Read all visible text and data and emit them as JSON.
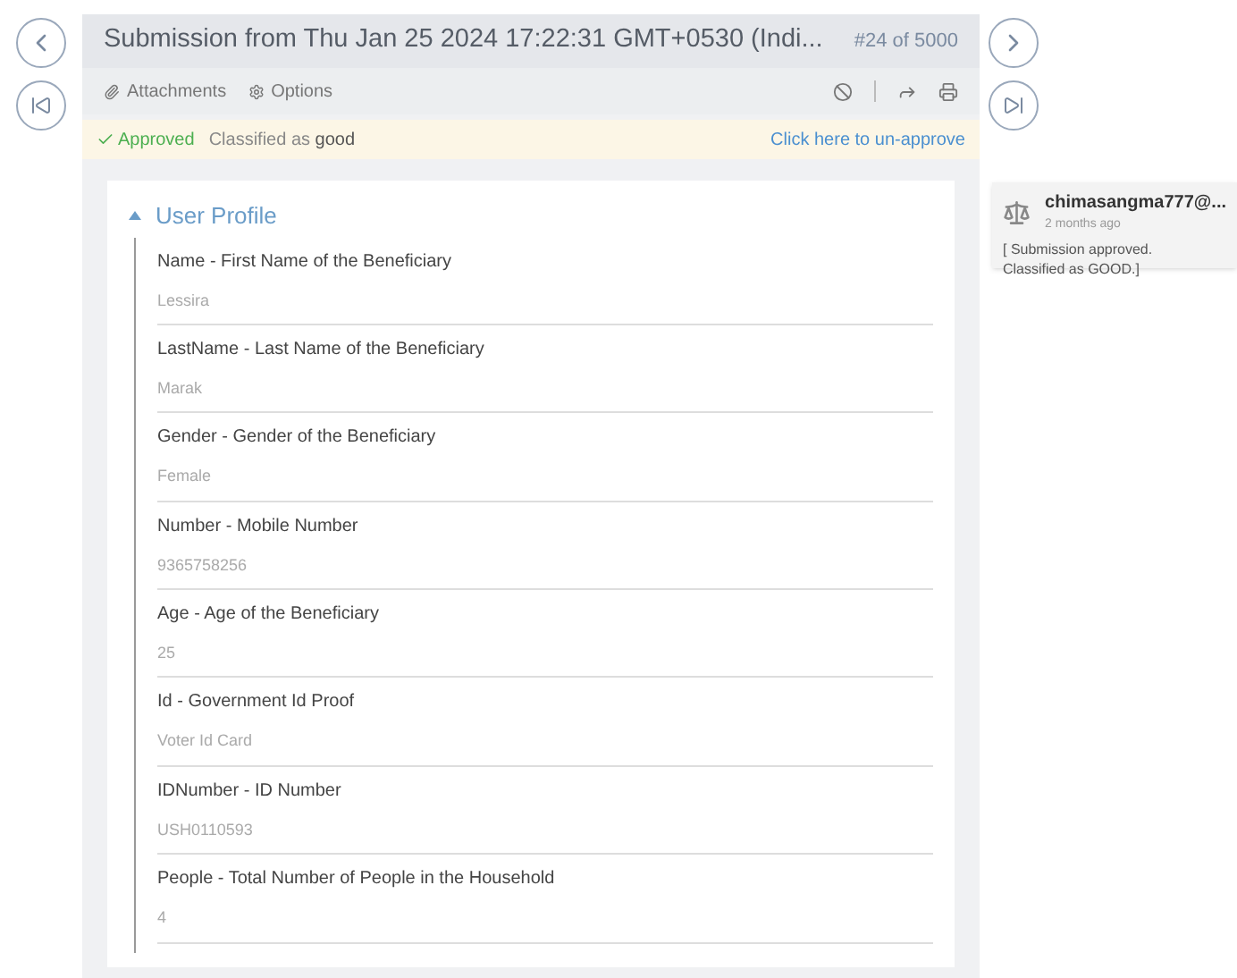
{
  "header": {
    "title": "Submission from Thu Jan 25 2024 17:22:31 GMT+0530 (Indi...",
    "counter": "#24 of 5000"
  },
  "toolbar": {
    "attachments": "Attachments",
    "options": "Options"
  },
  "status": {
    "approved": "Approved",
    "classified": "Classified as **good**",
    "unapprove": "Click here to un-approve"
  },
  "section": {
    "title": "User Profile",
    "expanded": true,
    "fields": [
      {
        "label": "Name - First Name of the Beneficiary",
        "value": "Lessira"
      },
      {
        "label": "LastName - Last Name of the Beneficiary",
        "value": "Marak"
      },
      {
        "label": "Gender - Gender of the Beneficiary",
        "value": "Female"
      },
      {
        "label": "Number - Mobile Number",
        "value": "9365758256"
      },
      {
        "label": "Age - Age of the Beneficiary",
        "value": "25"
      },
      {
        "label": "Id - Government Id Proof",
        "value": "Voter Id Card"
      },
      {
        "label": "IDNumber - ID Number",
        "value": "USH0110593"
      },
      {
        "label": "People - Total Number of People in the Household",
        "value": "4"
      }
    ]
  },
  "comment": {
    "author": "chimasangma777@...",
    "time": "2 months ago",
    "text": "[ Submission approved. Classified as GOOD.]"
  }
}
